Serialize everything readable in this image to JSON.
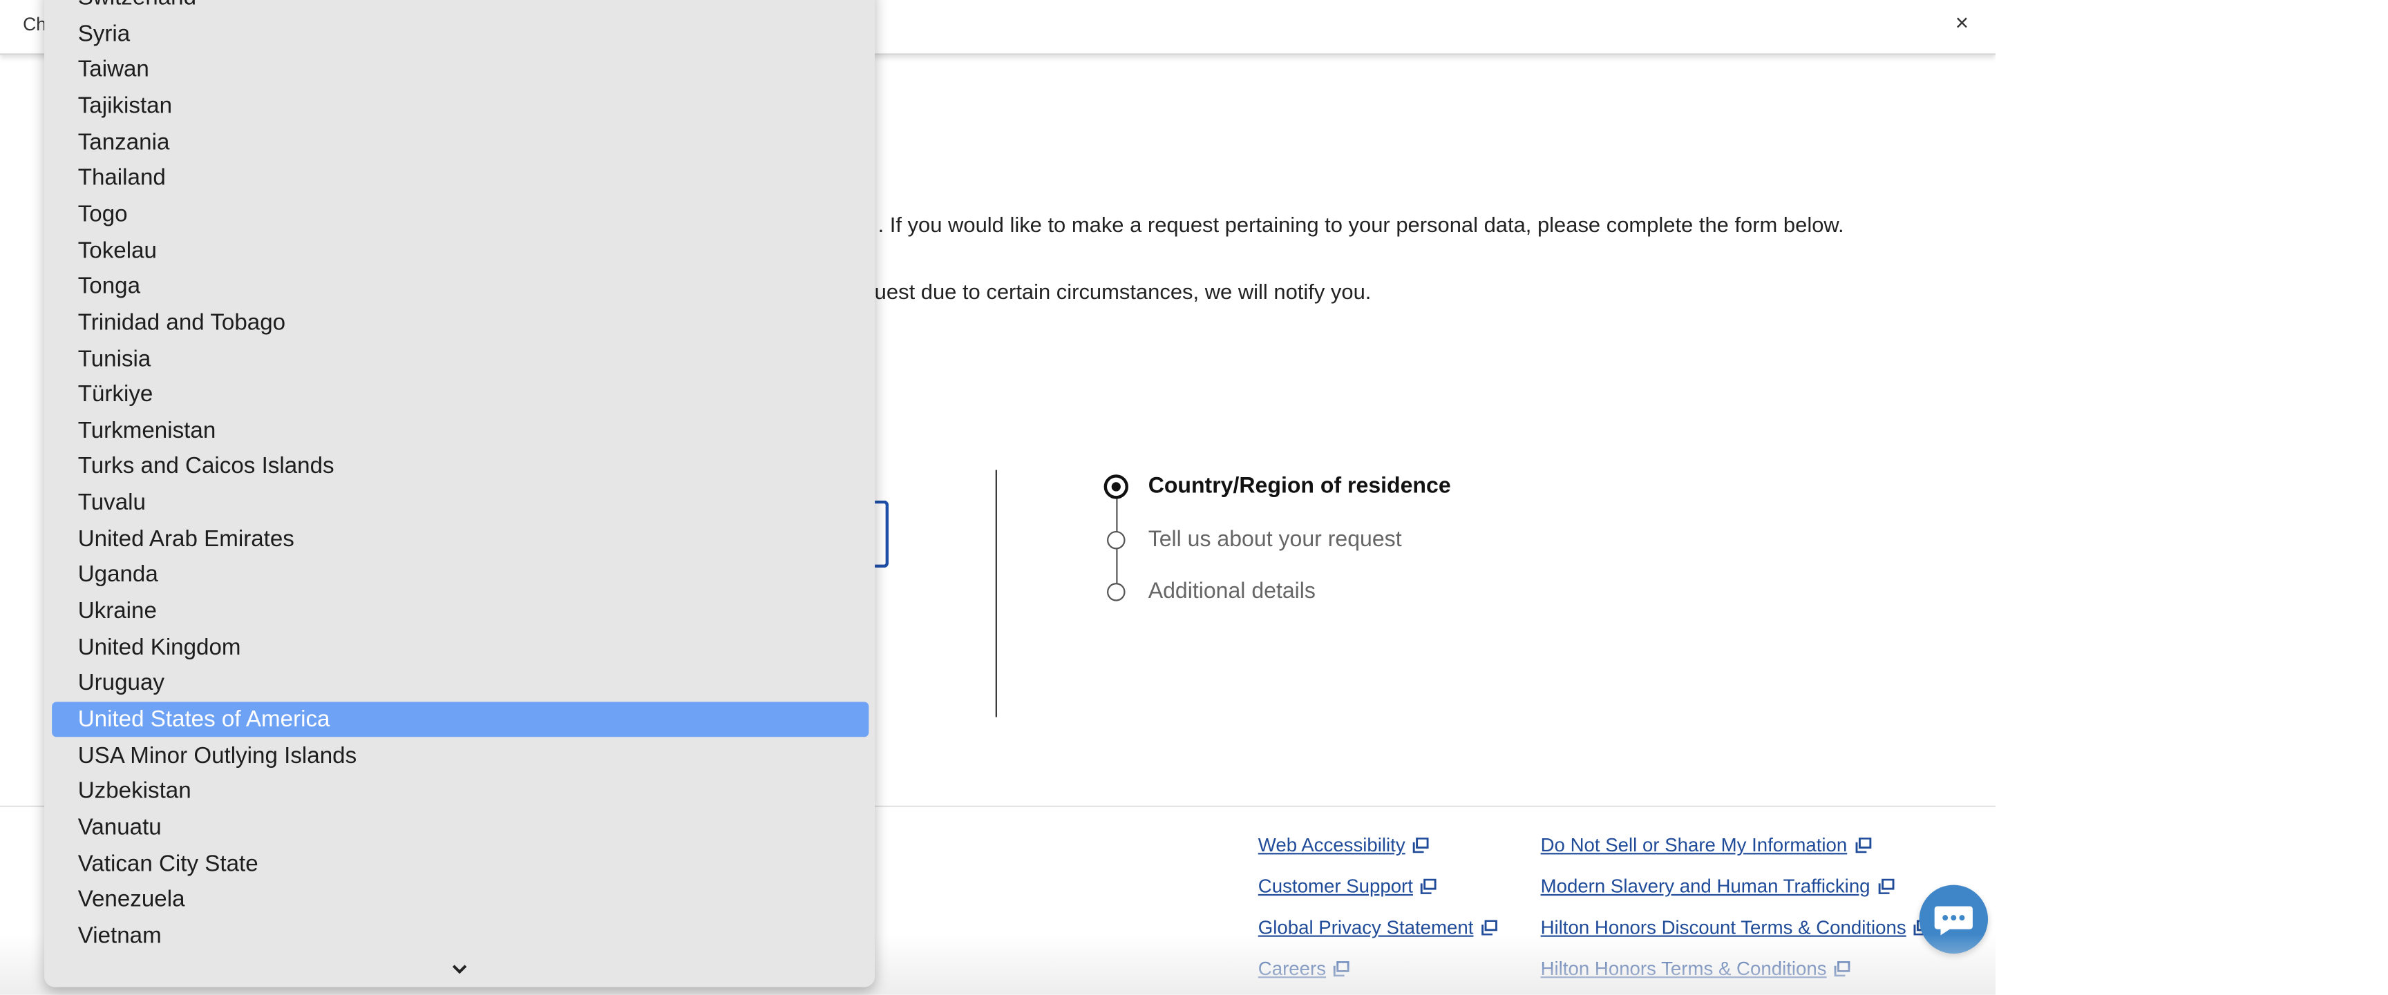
{
  "window": {
    "title": "Ch",
    "close_label": "×"
  },
  "intro": {
    "line1": ". If you would like to make a request pertaining to your personal data, please complete the form below.",
    "line2": "quest due to certain circumstances, we will notify you."
  },
  "stepper": {
    "steps": [
      {
        "label": "Country/Region of residence",
        "state": "current"
      },
      {
        "label": "Tell us about your request",
        "state": "pending"
      },
      {
        "label": "Additional details",
        "state": "pending"
      }
    ]
  },
  "footer": {
    "links_col1": [
      "Web Accessibility",
      "Customer Support",
      "Global Privacy Statement",
      "Careers"
    ],
    "links_col2": [
      "Do Not Sell or Share My Information",
      "Modern Slavery and Human Trafficking",
      "Hilton Honors Discount Terms & Conditions",
      "Hilton Honors Terms & Conditions"
    ],
    "link_color": "#1f4b99"
  },
  "chat": {
    "icon": "chat-bubble-icon",
    "color": "#3e86c8"
  },
  "dropdown": {
    "items": [
      "Switzerland",
      "Syria",
      "Taiwan",
      "Tajikistan",
      "Tanzania",
      "Thailand",
      "Togo",
      "Tokelau",
      "Tonga",
      "Trinidad and Tobago",
      "Tunisia",
      "Türkiye",
      "Turkmenistan",
      "Turks and Caicos Islands",
      "Tuvalu",
      "United Arab Emirates",
      "Uganda",
      "Ukraine",
      "United Kingdom",
      "Uruguay",
      "United States of America",
      "USA Minor Outlying Islands",
      "Uzbekistan",
      "Vanuatu",
      "Vatican City State",
      "Venezuela",
      "Vietnam"
    ],
    "selected": "United States of America",
    "selected_color": "#6ea2f5",
    "scroll_icon": "chevron-down-icon"
  }
}
